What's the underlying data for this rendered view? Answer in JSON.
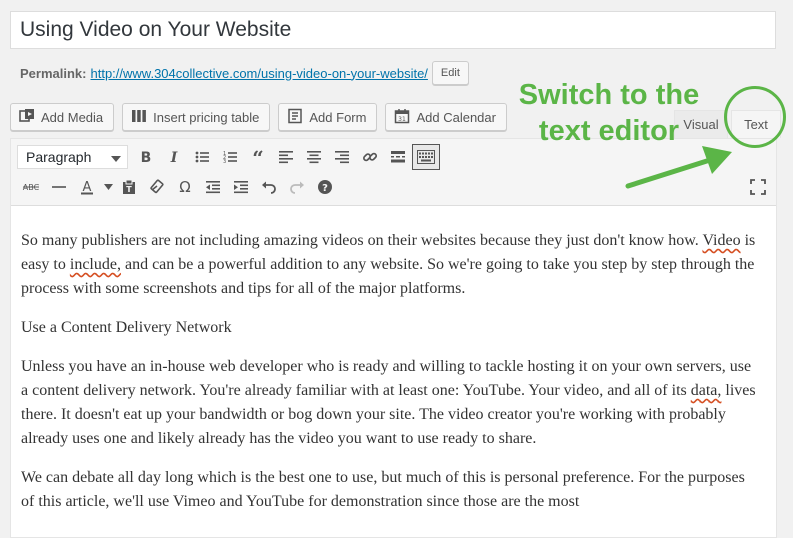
{
  "post_title": "Using Video on Your Website",
  "permalink": {
    "label": "Permalink:",
    "url": "http://www.304collective.com/using-video-on-your-website/",
    "edit_label": "Edit"
  },
  "media_buttons": [
    {
      "label": "Add Media",
      "icon": "media-icon"
    },
    {
      "label": "Insert pricing table",
      "icon": "pricing-table-icon"
    },
    {
      "label": "Add Form",
      "icon": "form-icon"
    },
    {
      "label": "Add Calendar",
      "icon": "calendar-icon"
    }
  ],
  "tabs": {
    "visual": "Visual",
    "text": "Text"
  },
  "format_select": "Paragraph",
  "annotation": {
    "line1": "Switch to the",
    "line2": "text editor",
    "color": "#5bb547"
  },
  "content": {
    "p1_a": "So many publishers are not including amazing videos on their websites because they just don't know how.  ",
    "p1_w1": "Video",
    "p1_b": " is easy to ",
    "p1_w2": "include,",
    "p1_c": " and can be a powerful addition to any website. So we're going to take you step by step through the process with some screenshots and tips for all of the major platforms.",
    "p2": "Use a Content Delivery Network",
    "p3_a": "Unless you have an in-house web developer who is ready and willing to tackle hosting it on your own servers, use a content delivery network.  You're already familiar with at least one: YouTube.  Your video, and all of its ",
    "p3_w1": "data,",
    "p3_b": " lives there.  It doesn't eat up your bandwidth or bog down your site.  The video creator you're working with probably already uses one and likely already has the video you want to use ready to share.",
    "p4": "We can debate all day long which is the best one to use, but much of this is personal preference.  For the purposes of this article, we'll use Vimeo and YouTube for demonstration since those are the most"
  }
}
